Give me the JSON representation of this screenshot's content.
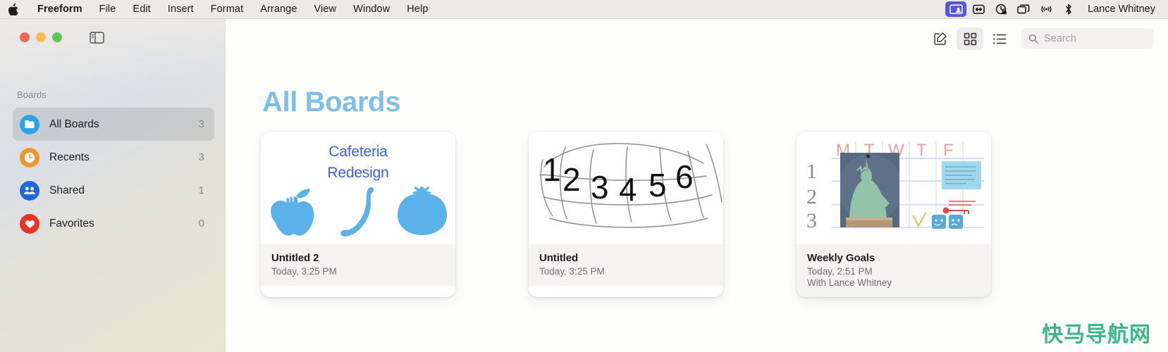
{
  "menubar": {
    "apple_icon": "apple-logo",
    "items": [
      {
        "label": "Freeform",
        "bold": true
      },
      {
        "label": "File"
      },
      {
        "label": "Edit"
      },
      {
        "label": "Insert"
      },
      {
        "label": "Format"
      },
      {
        "label": "Arrange"
      },
      {
        "label": "View"
      },
      {
        "label": "Window"
      },
      {
        "label": "Help"
      }
    ],
    "status_icons": [
      {
        "name": "screen-sharing-icon",
        "active": true
      },
      {
        "name": "stage-manager-icon",
        "active": false
      },
      {
        "name": "focus-lock-icon",
        "active": false
      },
      {
        "name": "display-mirror-icon",
        "active": false
      },
      {
        "name": "airplay-icon",
        "active": false
      },
      {
        "name": "bluetooth-icon",
        "active": false
      }
    ],
    "user_name": "Lance Whitney",
    "active_icon_color": "#5856e0"
  },
  "window": {
    "traffic_lights": [
      {
        "name": "close-button",
        "color": "#f1655b"
      },
      {
        "name": "minimize-button",
        "color": "#f5bf4f"
      },
      {
        "name": "maximize-button",
        "color": "#61c456"
      }
    ],
    "sidebar_toggle_icon": "sidebar-toggle-icon"
  },
  "sidebar": {
    "section_header": "Boards",
    "items": [
      {
        "label": "All Boards",
        "count": "3",
        "icon": "boards-icon",
        "color": "#2ca5e8",
        "selected": true
      },
      {
        "label": "Recents",
        "count": "3",
        "icon": "clock-icon",
        "color": "#f0962a",
        "selected": false
      },
      {
        "label": "Shared",
        "count": "1",
        "icon": "people-icon",
        "color": "#1b68e0",
        "selected": false
      },
      {
        "label": "Favorites",
        "count": "0",
        "icon": "heart-icon",
        "color": "#e8352a",
        "selected": false
      }
    ]
  },
  "toolbar": {
    "new_board_icon": "compose-icon",
    "grid_view_icon": "grid-view-icon",
    "list_view_icon": "list-view-icon",
    "grid_view_selected": true,
    "search": {
      "icon": "search-icon",
      "value": "",
      "placeholder": "Search"
    }
  },
  "main": {
    "title": "All Boards",
    "title_color": "#82bfe8",
    "boards": [
      {
        "title": "Untitled 2",
        "subtitle": "Today, 3:25 PM",
        "shared_with": "",
        "thumbnail": {
          "kind": "cafeteria-sketch",
          "text_lines": [
            "Cafeteria",
            "Redesign"
          ],
          "text_color": "#3b5fe0",
          "shapes": [
            "apple",
            "banana",
            "tomato"
          ],
          "shape_color": "#5ab2e8"
        }
      },
      {
        "title": "Untitled",
        "subtitle": "Today, 3:25 PM",
        "shared_with": "",
        "thumbnail": {
          "kind": "numbers-scribble",
          "numbers": [
            "1",
            "2",
            "3",
            "4",
            "5",
            "6"
          ],
          "number_color": "#111111",
          "scribble_color": "#8e8e93"
        }
      },
      {
        "title": "Weekly Goals",
        "subtitle": "Today, 2:51 PM",
        "shared_with": "With Lance Whitney",
        "thumbnail": {
          "kind": "weekly-planner",
          "day_labels": [
            "M",
            "T",
            "W",
            "T",
            "F"
          ],
          "day_label_color": "#e8a0a4",
          "row_numbers": [
            "1",
            "2",
            "3"
          ],
          "row_number_color": "#8a8a8f",
          "grid_line_color": "#b9c6e8",
          "photo": "statue-of-liberty-photo",
          "sticky_note_color": "#9ed8f0",
          "emoji_stickers": [
            "performing-arts",
            "performing-arts"
          ],
          "key_sticker": "key-icon"
        }
      }
    ]
  },
  "watermark": {
    "text": "快马导航网",
    "color": "#3cb68b"
  }
}
